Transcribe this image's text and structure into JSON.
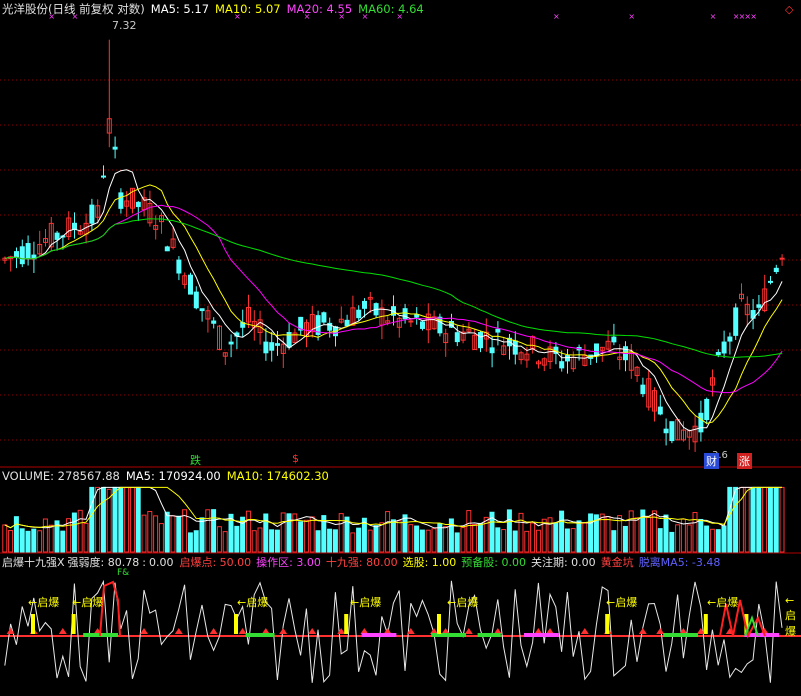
{
  "main_header": {
    "title": "光洋股份(日线 前复权 对数)",
    "ma5": "MA5: 5.17",
    "ma10": "MA10: 5.07",
    "ma20": "MA20: 4.55",
    "ma60": "MA60: 4.64"
  },
  "volume_header": {
    "label": "VOLUME: 278567.88",
    "ma5": "MA5: 170924.00",
    "ma10": "MA10: 174602.30"
  },
  "indicator_header": {
    "name": "启爆十九强X",
    "strength": "强弱度: 80.78",
    "sep": ":",
    "zero": "0.00",
    "qibaodian": "启爆点: 50.00",
    "caozuoqu": "操作区: 3.00",
    "shijiuqiang": "十九强: 80.00",
    "xuangu": "选股: 1.00",
    "yubeigu": "预备股: 0.00",
    "guanzhuqi": "关注期: 0.00",
    "huangjinkeng": "黄金坑",
    "weiduan": "脱离MA5: -3.48"
  },
  "annotations": {
    "high_label": "7.32",
    "low_label": "3.6",
    "die": "跌",
    "dollar": "$",
    "cai": "财",
    "zhang": "涨",
    "qibao": "启爆",
    "qibao_arrow": "←启爆",
    "indicator_top": "F&"
  },
  "colors": {
    "up": "#ff3232",
    "down": "#54ffff",
    "ma5": "#ffffff",
    "ma10": "#ffff00",
    "ma20": "#ff00ff",
    "ma60": "#00e000",
    "grid": "#8b0000",
    "background": "#000000"
  },
  "chart_data": {
    "type": "candlestick",
    "title": "光洋股份(日线 前复权 对数)",
    "scale": "log",
    "ylim": [
      3.5,
      7.5
    ],
    "high": 7.32,
    "low": 3.6,
    "series": [
      {
        "name": "MA5",
        "last": 5.17
      },
      {
        "name": "MA10",
        "last": 5.07
      },
      {
        "name": "MA20",
        "last": 4.55
      },
      {
        "name": "MA60",
        "last": 4.64
      }
    ],
    "volume": {
      "last": 278567.88,
      "ma5": 170924.0,
      "ma10": 174602.3
    },
    "indicator": {
      "strength": 80.78,
      "qibaodian": 50.0,
      "caozuoqu": 3.0,
      "shijiuqiang": 80.0,
      "xuangu": 1.0,
      "yubeigu": 0.0,
      "guanzhuqi": 0.0,
      "ma5_distance": -3.48
    }
  }
}
